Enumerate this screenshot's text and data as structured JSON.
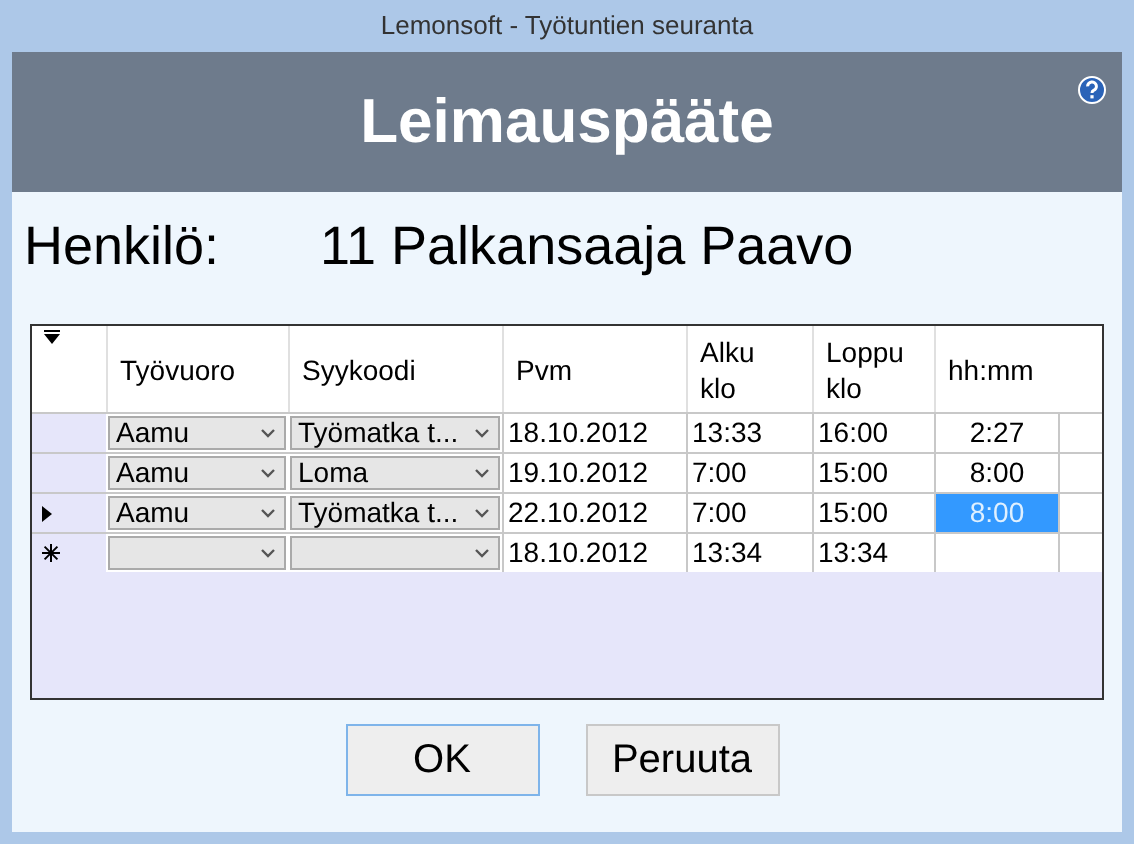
{
  "window": {
    "title": "Lemonsoft - Työtuntien seuranta"
  },
  "header": {
    "title": "Leimauspääte"
  },
  "person": {
    "label": "Henkilö:",
    "value": "11 Palkansaaja Paavo"
  },
  "table": {
    "columns": [
      "Työvuoro",
      "Syykoodi",
      "Pvm",
      "Alku\nklo",
      "Loppu\nklo",
      "hh:mm"
    ],
    "rows": [
      {
        "current": false,
        "new_row": false,
        "shift": "Aamu",
        "reason": "Työmatka t...",
        "date": "18.10.2012",
        "start": "13:33",
        "end": "16:00",
        "hours": "2:27",
        "hours_selected": false
      },
      {
        "current": false,
        "new_row": false,
        "shift": "Aamu",
        "reason": "Loma",
        "date": "19.10.2012",
        "start": "7:00",
        "end": "15:00",
        "hours": "8:00",
        "hours_selected": false
      },
      {
        "current": true,
        "new_row": false,
        "shift": "Aamu",
        "reason": "Työmatka t...",
        "date": "22.10.2012",
        "start": "7:00",
        "end": "15:00",
        "hours": "8:00",
        "hours_selected": true
      },
      {
        "current": false,
        "new_row": true,
        "date": "18.10.2012",
        "start": "13:34",
        "end": "13:34",
        "hours_selected": false
      }
    ]
  },
  "buttons": [
    {
      "label": "OK",
      "default": true
    },
    {
      "label": "Peruuta",
      "default": false
    }
  ]
}
